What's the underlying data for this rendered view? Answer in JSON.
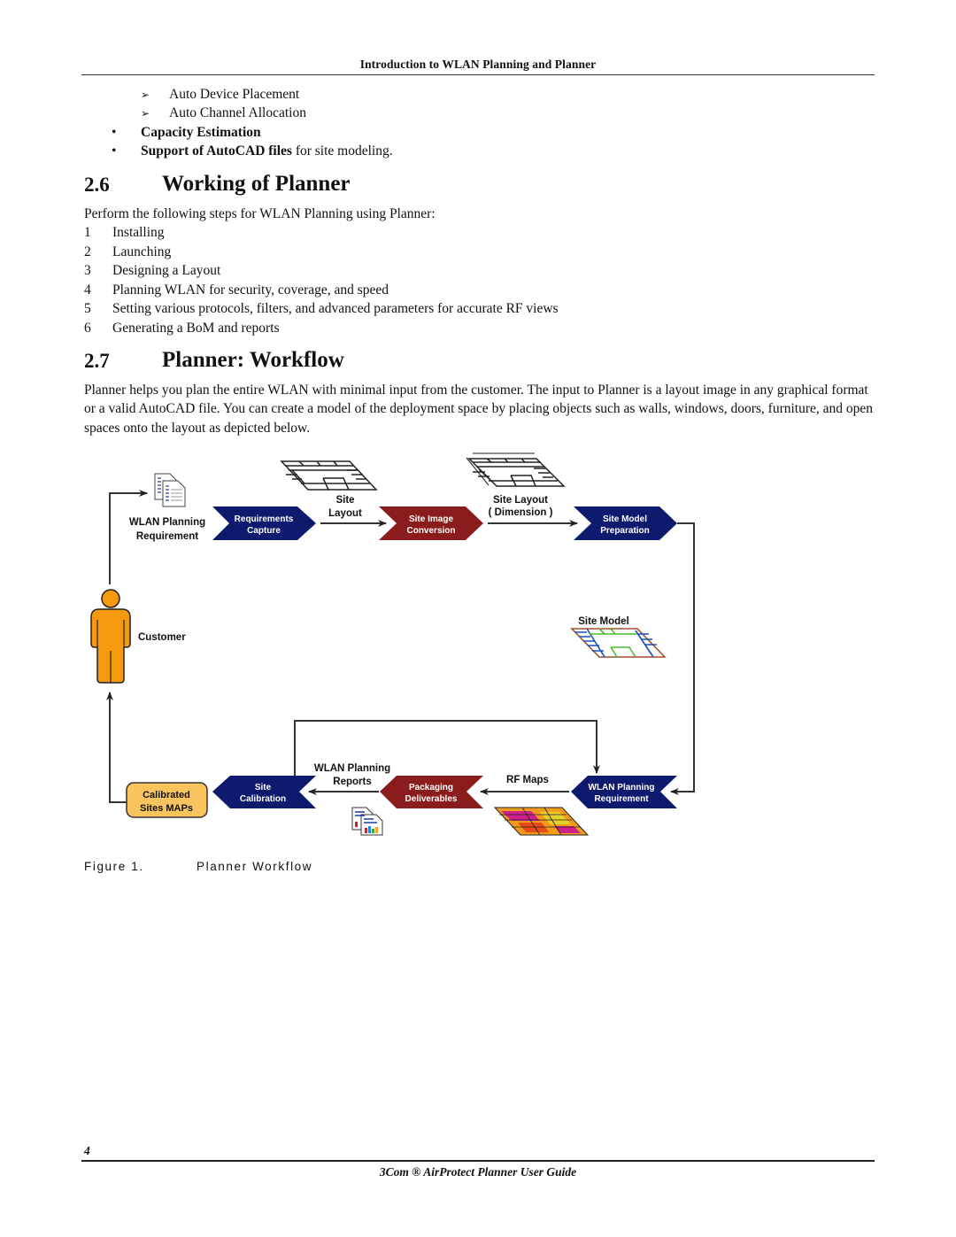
{
  "header": {
    "running_title": "Introduction to WLAN Planning and Planner"
  },
  "feature_list": {
    "sub_items": [
      "Auto Device Placement",
      "Auto Channel Allocation"
    ],
    "bullets": [
      {
        "bold": "Capacity Estimation",
        "rest": ""
      },
      {
        "bold": "Support of AutoCAD files",
        "rest": " for site modeling."
      }
    ]
  },
  "section_2_6": {
    "number": "2.6",
    "title": "Working of Planner",
    "intro": "Perform the following steps for WLAN Planning using Planner:",
    "steps": [
      {
        "n": "1",
        "text": "Installing"
      },
      {
        "n": "2",
        "text": "Launching"
      },
      {
        "n": "3",
        "text": "Designing a Layout"
      },
      {
        "n": "4",
        "text": "Planning WLAN for security, coverage, and speed"
      },
      {
        "n": "5",
        "text": "Setting various protocols, filters, and advanced parameters for accurate RF views"
      },
      {
        "n": "6",
        "text": "Generating a BoM and reports"
      }
    ]
  },
  "section_2_7": {
    "number": "2.7",
    "title": "Planner: Workflow",
    "paragraph": "Planner helps you plan the entire WLAN with minimal input from the customer. The input to Planner is a layout image in any graphical format or a valid AutoCAD file. You can create a model of the deployment space by placing objects such as walls, windows, doors, furniture, and open spaces onto the layout as depicted below."
  },
  "diagram": {
    "colors": {
      "navy": "#0d1a6e",
      "maroon": "#8b1c1c",
      "orange": "#f59a0c",
      "calibrated": "#f9c45e",
      "line": "#333333"
    },
    "nodes": {
      "requirements_capture": [
        "Requirements",
        "Capture"
      ],
      "site_image_conversion": [
        "Site Image",
        "Conversion"
      ],
      "site_model_preparation": [
        "Site Model",
        "Preparation"
      ],
      "wlan_planning_requirement": [
        "WLAN Planning",
        "Requirement"
      ],
      "packaging_deliverables": [
        "Packaging",
        "Deliverables"
      ],
      "site_calibration": [
        "Site",
        "Calibration"
      ],
      "calibrated_sites_maps": [
        "Calibrated",
        "Sites MAPs"
      ]
    },
    "labels": {
      "wlan_planning_requirement_input": [
        "WLAN Planning",
        "Requirement"
      ],
      "site_layout": [
        "Site",
        "Layout"
      ],
      "site_layout_dimension": [
        "Site Layout",
        "( Dimension )"
      ],
      "site_model": "Site Model",
      "customer": "Customer",
      "wlan_planning_reports": [
        "WLAN Planning",
        "Reports"
      ],
      "rf_maps": "RF Maps"
    }
  },
  "figure": {
    "label": "Figure 1.",
    "caption": "Planner Workflow"
  },
  "footer": {
    "page_number": "4",
    "guide_title": "3Com ® AirProtect Planner User Guide"
  }
}
